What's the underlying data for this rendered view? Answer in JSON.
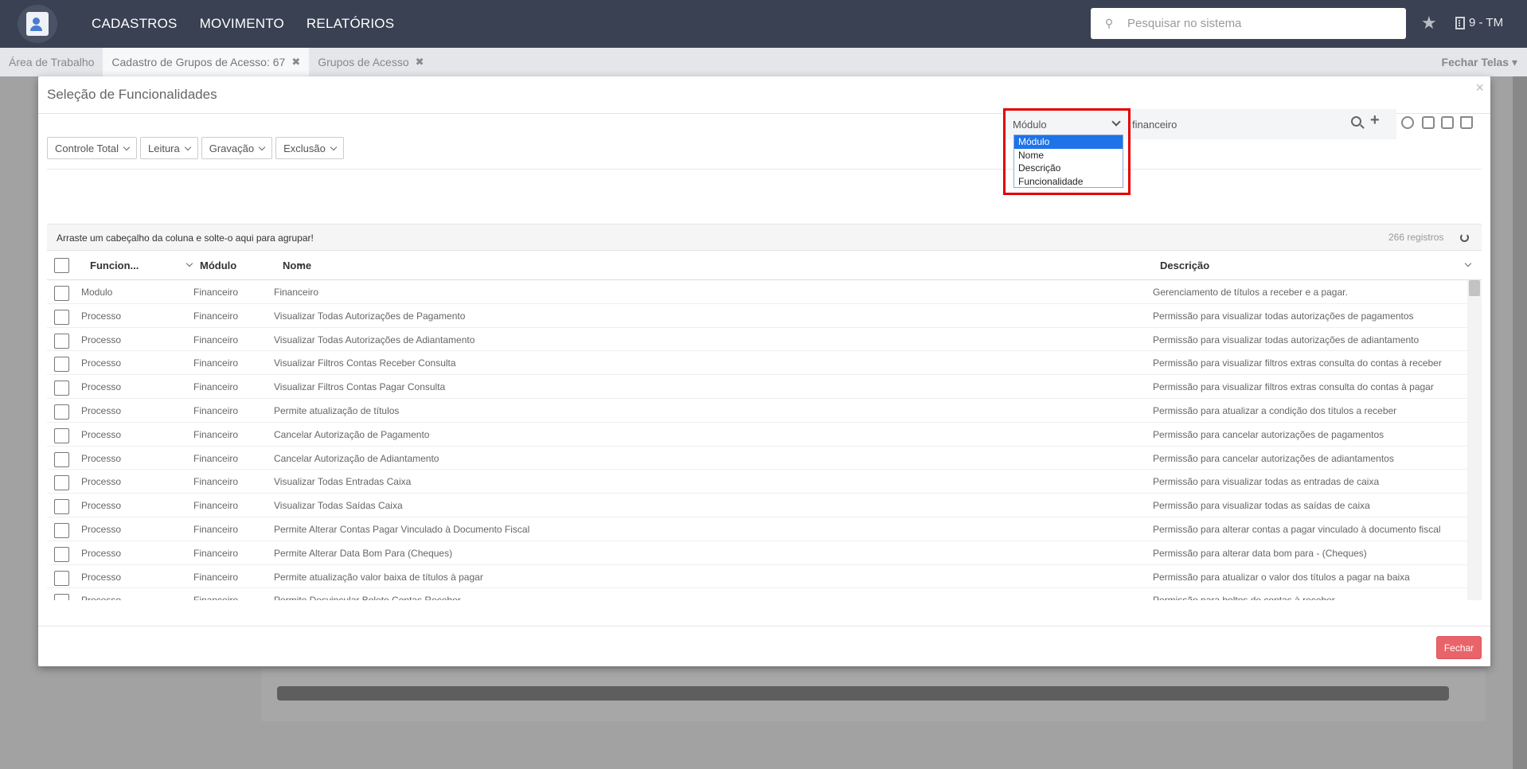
{
  "nav": {
    "items": [
      "CADASTROS",
      "MOVIMENTO",
      "RELATÓRIOS"
    ],
    "search_placeholder": "Pesquisar no sistema",
    "company": "9 - TM"
  },
  "tabs": [
    {
      "label": "Área de Trabalho"
    },
    {
      "label": "Cadastro de Grupos de Acesso: 67"
    },
    {
      "label": "Grupos de Acesso"
    }
  ],
  "close_all_label": "Fechar Telas",
  "modal": {
    "title": "Seleção de Funcionalidades",
    "permission_buttons": [
      "Controle Total",
      "Leitura",
      "Gravação",
      "Exclusão"
    ],
    "filter": {
      "field": "Módulo",
      "options": [
        "Módulo",
        "Nome",
        "Descrição",
        "Funcionalidade"
      ],
      "selected_option": "Módulo",
      "value": "financeiro"
    },
    "group_hint": "Arraste um cabeçalho da coluna e solte-o aqui para agrupar!",
    "record_count": "266 registros",
    "columns": [
      "Funcion...",
      "Módulo",
      "Nome",
      "Descrição"
    ],
    "rows": [
      {
        "func": "Modulo",
        "mod": "Financeiro",
        "nome": "Financeiro",
        "desc": "Gerenciamento de títulos a receber e a pagar."
      },
      {
        "func": "Processo",
        "mod": "Financeiro",
        "nome": "Visualizar Todas Autorizações de Pagamento",
        "desc": "Permissão para visualizar todas autorizações de pagamentos"
      },
      {
        "func": "Processo",
        "mod": "Financeiro",
        "nome": "Visualizar Todas Autorizações de Adiantamento",
        "desc": "Permissão para visualizar todas autorizações de adiantamento"
      },
      {
        "func": "Processo",
        "mod": "Financeiro",
        "nome": "Visualizar Filtros Contas Receber Consulta",
        "desc": "Permissão para visualizar filtros extras consulta do contas à receber"
      },
      {
        "func": "Processo",
        "mod": "Financeiro",
        "nome": "Visualizar Filtros Contas Pagar Consulta",
        "desc": "Permissão para visualizar filtros extras consulta do contas à pagar"
      },
      {
        "func": "Processo",
        "mod": "Financeiro",
        "nome": "Permite atualização de títulos",
        "desc": "Permissão para atualizar a condição dos títulos a receber"
      },
      {
        "func": "Processo",
        "mod": "Financeiro",
        "nome": "Cancelar Autorização de Pagamento",
        "desc": "Permissão para cancelar autorizações de pagamentos"
      },
      {
        "func": "Processo",
        "mod": "Financeiro",
        "nome": "Cancelar Autorização de Adiantamento",
        "desc": "Permissão para cancelar autorizações de adiantamentos"
      },
      {
        "func": "Processo",
        "mod": "Financeiro",
        "nome": "Visualizar Todas Entradas Caixa",
        "desc": "Permissão para visualizar todas as entradas de caixa"
      },
      {
        "func": "Processo",
        "mod": "Financeiro",
        "nome": "Visualizar Todas Saídas Caixa",
        "desc": "Permissão para visualizar todas as saídas de caixa"
      },
      {
        "func": "Processo",
        "mod": "Financeiro",
        "nome": "Permite Alterar Contas Pagar Vinculado à Documento Fiscal",
        "desc": "Permissão para alterar contas a pagar vinculado à documento fiscal"
      },
      {
        "func": "Processo",
        "mod": "Financeiro",
        "nome": "Permite Alterar Data Bom Para (Cheques)",
        "desc": "Permissão para alterar data bom para - (Cheques)"
      },
      {
        "func": "Processo",
        "mod": "Financeiro",
        "nome": "Permite atualização valor baixa de títulos à pagar",
        "desc": "Permissão para atualizar o valor dos títulos a pagar na baixa"
      },
      {
        "func": "Processo",
        "mod": "Financeiro",
        "nome": "Permite Desvincular Boleto Contas Receber",
        "desc": "Permissão para boltos de contas à receber"
      }
    ],
    "close_button": "Fechar"
  },
  "colors": {
    "navbar": "#3a4152",
    "highlight_box": "#e20000",
    "close_button": "#e9646a",
    "dropdown_selected": "#1e73e8"
  }
}
